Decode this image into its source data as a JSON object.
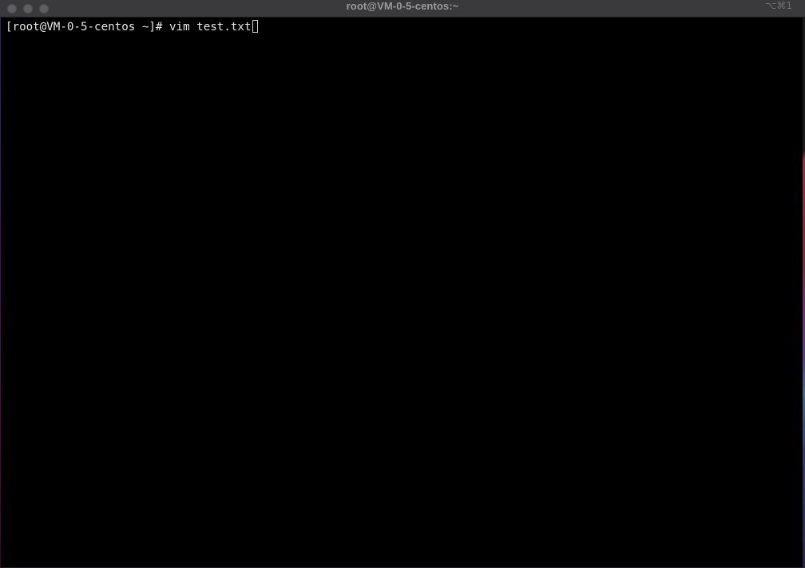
{
  "window": {
    "title": "root@VM-0-5-centos:~",
    "shortcut": "⌥⌘1"
  },
  "terminal": {
    "prompt_line": "[root@VM-0-5-centos ~]# vim test.txt"
  },
  "colors": {
    "background": "#000000",
    "titlebar": "#3a3a3c",
    "text": "#e6e6e6"
  }
}
